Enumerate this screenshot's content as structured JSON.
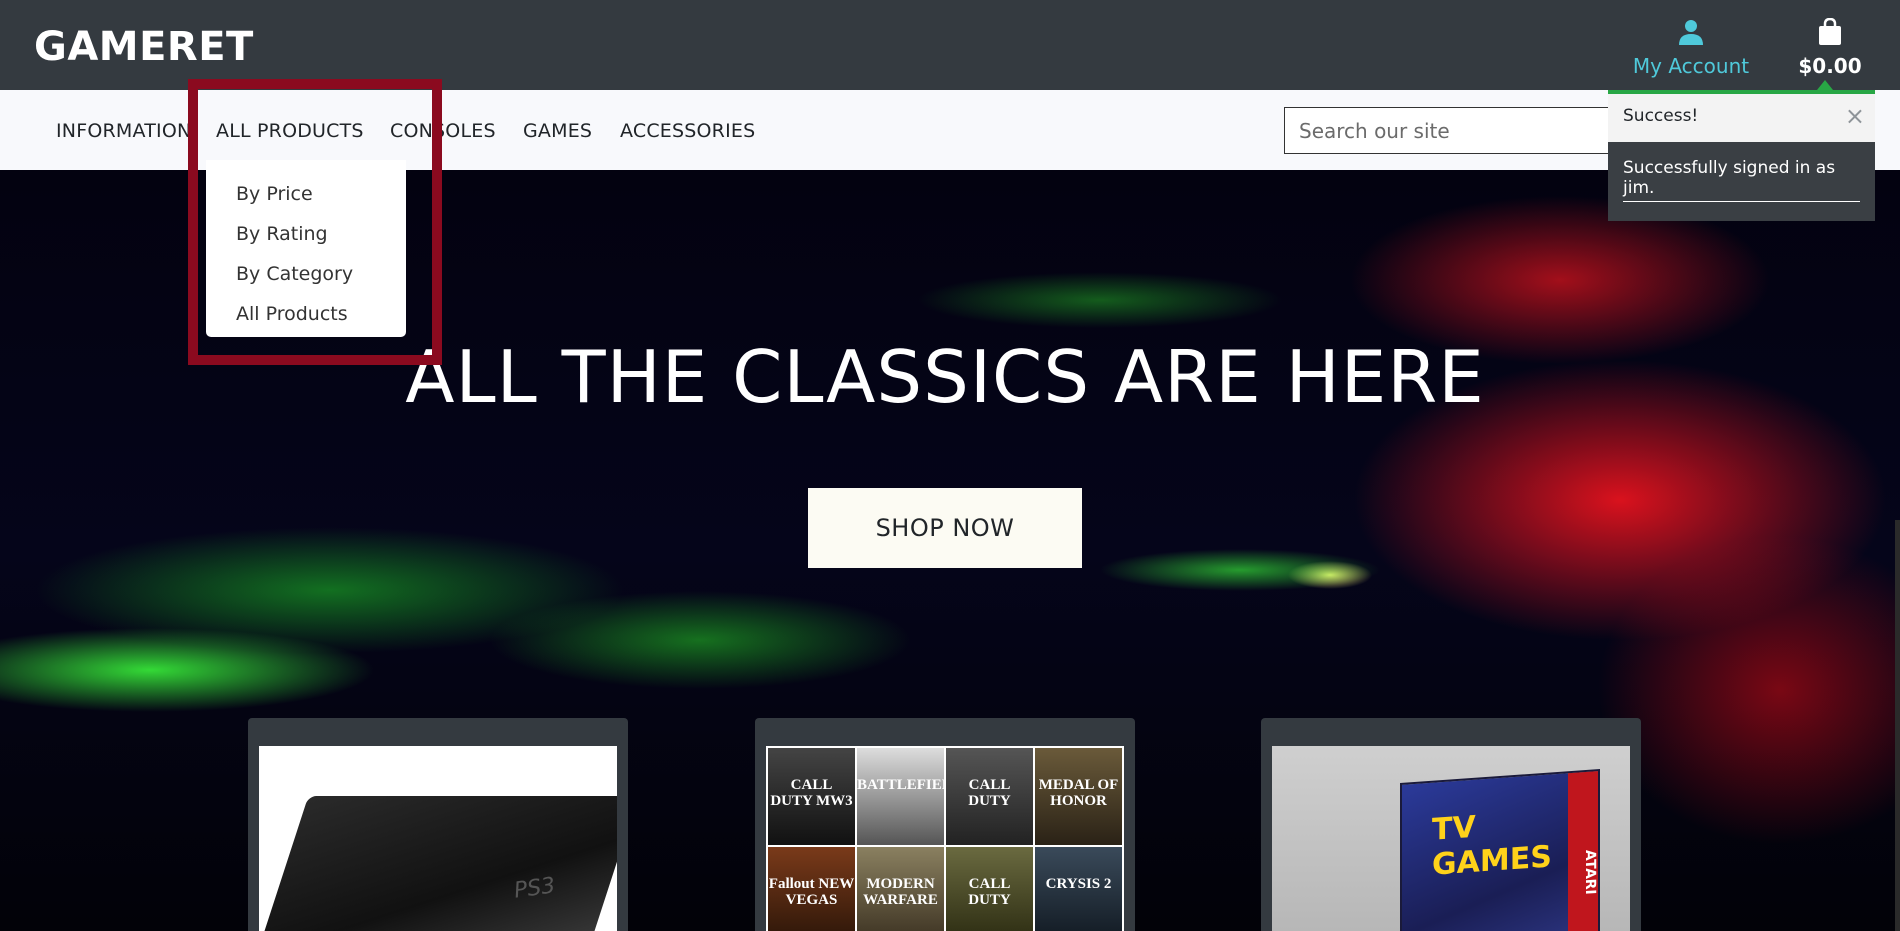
{
  "header": {
    "logo": "GAMERET",
    "account_label": "My Account",
    "cart_total": "$0.00",
    "account_icon": "user-icon",
    "cart_icon": "shopping-bag-icon",
    "accent_color": "#4fc9da"
  },
  "nav": {
    "items": [
      "INFORMATION",
      "ALL PRODUCTS",
      "CONSOLES",
      "GAMES",
      "ACCESSORIES"
    ],
    "search_placeholder": "Search our site"
  },
  "dropdown": {
    "items": [
      "By Price",
      "By Rating",
      "By Category",
      "All Products"
    ]
  },
  "hero": {
    "title": "ALL THE CLASSICS ARE HERE",
    "cta": "SHOP NOW"
  },
  "cards": {
    "console_caption": "PS3",
    "games": [
      "CALL DUTY MW3",
      "BATTLEFIELD",
      "CALL DUTY",
      "MEDAL OF HONOR",
      "Fallout NEW VEGAS",
      "MODERN WARFARE",
      "CALL DUTY",
      "CRYSIS 2"
    ],
    "plug_play_title": "TV GAMES",
    "plug_play_brand": "ATARI"
  },
  "toast": {
    "title": "Success!",
    "message": "Successfully signed in as jim.",
    "close": "×",
    "status_color": "#28a745"
  }
}
